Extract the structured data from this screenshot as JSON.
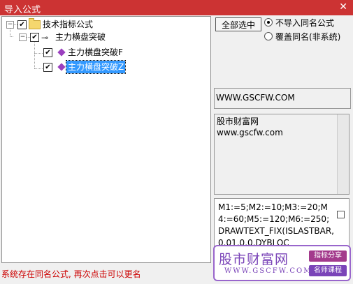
{
  "window": {
    "title": "导入公式",
    "close_glyph": "✕"
  },
  "tree": {
    "root": {
      "label": "技术指标公式",
      "checked": "✔",
      "expander": "−"
    },
    "group": {
      "label": "主力横盘突破",
      "checked": "✔",
      "expander": "−"
    },
    "items": [
      {
        "label": "主力横盘突破F",
        "checked": "✔"
      },
      {
        "label": "主力横盘突破Z",
        "checked": "✔",
        "selected": true
      }
    ]
  },
  "controls": {
    "select_all": "全部选中",
    "radio_options": [
      {
        "label": "不导入同名公式",
        "selected": true
      },
      {
        "label": "覆盖同名(非系统)",
        "selected": false
      }
    ]
  },
  "info": {
    "url": "WWW.GSCFW.COM",
    "desc_line1": "股市财富网",
    "desc_line2": "www.gscfw.com",
    "code": "M1:=5;M2:=10;M3:=20;M4:=60;M5:=120;M6:=250;DRAWTEXT_FIX(ISLASTBAR,0.01,0,0,DYBLOC"
  },
  "status": "系统存在同名公式, 再次点击可以更名",
  "watermark": {
    "brand": "股市财富网",
    "site": "WWW.GSCFW.COM",
    "tag1": "指标分享",
    "tag2": "名师课程"
  }
}
